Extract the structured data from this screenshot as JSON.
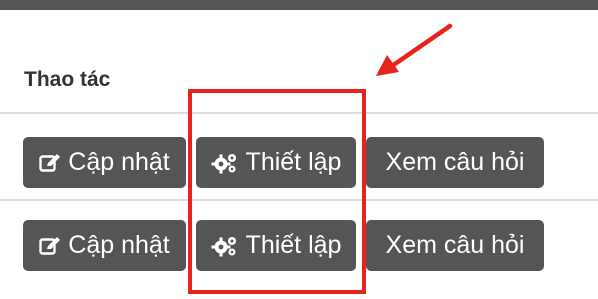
{
  "table": {
    "header": "Thao tác",
    "rows": [
      {
        "update_label": "Cập nhật",
        "setup_label": "Thiết lập",
        "view_label": "Xem câu hỏi"
      },
      {
        "update_label": "Cập nhật",
        "setup_label": "Thiết lập",
        "view_label": "Xem câu hỏi"
      }
    ]
  },
  "icons": {
    "update": "edit-icon",
    "setup": "gears-icon"
  },
  "colors": {
    "button_bg": "#555555",
    "button_text": "#ffffff",
    "annotation": "#e8231b",
    "header_text": "#333333"
  }
}
